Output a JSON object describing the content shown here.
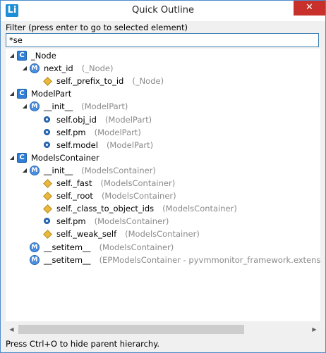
{
  "window": {
    "app_icon": "Li",
    "title": "Quick Outline",
    "close_glyph": "✕"
  },
  "filter": {
    "label": "Filter (press enter to go to selected element)",
    "value": "*se"
  },
  "tree": [
    {
      "level": 0,
      "twisty": "open",
      "icon": "class-icon",
      "name": "_Node",
      "context": ""
    },
    {
      "level": 1,
      "twisty": "open",
      "icon": "method-icon",
      "name": "next_id",
      "context": "(_Node)"
    },
    {
      "level": 2,
      "twisty": "",
      "icon": "protected-field-icon",
      "name": "self._prefix_to_id",
      "context": "(_Node)"
    },
    {
      "level": 0,
      "twisty": "open",
      "icon": "class-icon",
      "name": "ModelPart",
      "context": ""
    },
    {
      "level": 1,
      "twisty": "open",
      "icon": "method-icon",
      "name": "__init__",
      "context": "(ModelPart)"
    },
    {
      "level": 2,
      "twisty": "",
      "icon": "public-field-icon",
      "name": "self.obj_id",
      "context": "(ModelPart)"
    },
    {
      "level": 2,
      "twisty": "",
      "icon": "public-field-icon",
      "name": "self.pm",
      "context": "(ModelPart)"
    },
    {
      "level": 2,
      "twisty": "",
      "icon": "public-field-icon",
      "name": "self.model",
      "context": "(ModelPart)"
    },
    {
      "level": 0,
      "twisty": "open",
      "icon": "class-icon",
      "name": "ModelsContainer",
      "context": ""
    },
    {
      "level": 1,
      "twisty": "open",
      "icon": "method-icon",
      "name": "__init__",
      "context": "(ModelsContainer)"
    },
    {
      "level": 2,
      "twisty": "",
      "icon": "protected-field-icon",
      "name": "self._fast",
      "context": "(ModelsContainer)"
    },
    {
      "level": 2,
      "twisty": "",
      "icon": "protected-field-icon",
      "name": "self._root",
      "context": "(ModelsContainer)"
    },
    {
      "level": 2,
      "twisty": "",
      "icon": "protected-field-icon",
      "name": "self._class_to_object_ids",
      "context": "(ModelsContainer)"
    },
    {
      "level": 2,
      "twisty": "",
      "icon": "public-field-icon",
      "name": "self.pm",
      "context": "(ModelsContainer)"
    },
    {
      "level": 2,
      "twisty": "",
      "icon": "protected-field-icon",
      "name": "self._weak_self",
      "context": "(ModelsContainer)"
    },
    {
      "level": 1,
      "twisty": "",
      "icon": "method-icon",
      "name": "__setitem__",
      "context": "(ModelsContainer)"
    },
    {
      "level": 1,
      "twisty": "",
      "icon": "method-icon",
      "name": "__setitem__",
      "context": "(EPModelsContainer - pyvmmonitor_framework.extensions"
    }
  ],
  "status": {
    "text": "Press Ctrl+O to hide parent hierarchy."
  },
  "scrollbar": {
    "left_glyph": "◀",
    "right_glyph": "▶"
  }
}
